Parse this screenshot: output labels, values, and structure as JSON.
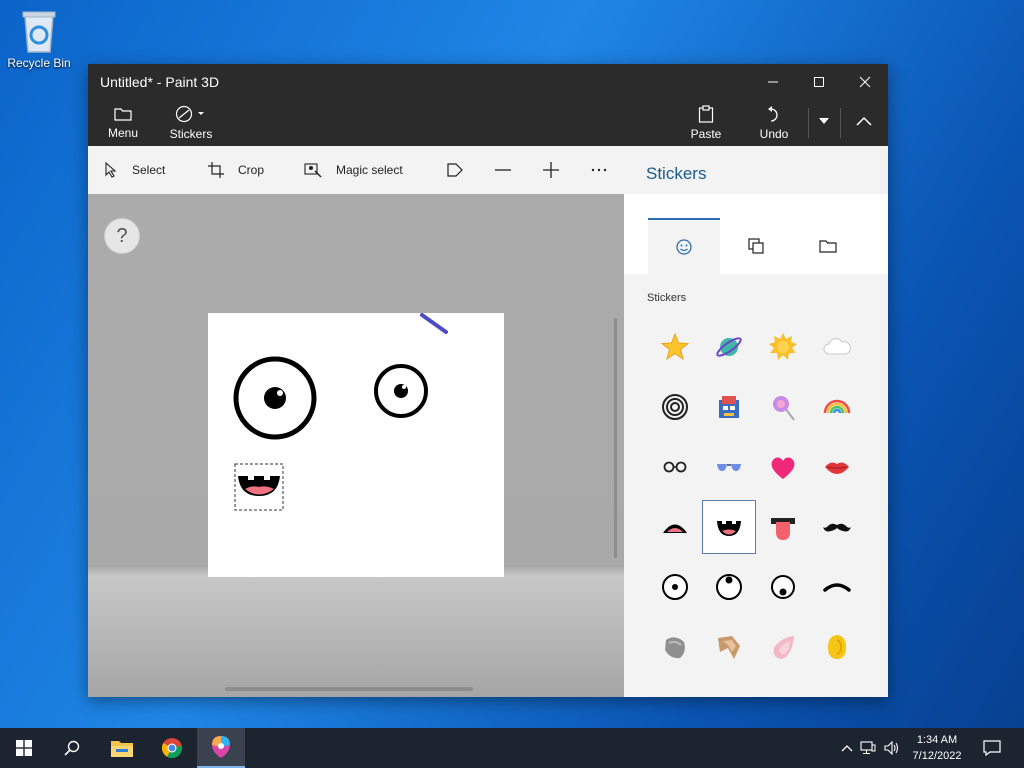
{
  "desktop": {
    "recycle_bin_label": "Recycle Bin"
  },
  "window": {
    "title": "Untitled* - Paint 3D",
    "ribbon": {
      "menu_label": "Menu",
      "stickers_label": "Stickers",
      "paste_label": "Paste",
      "undo_label": "Undo"
    },
    "toolbar": {
      "select_label": "Select",
      "crop_label": "Crop",
      "magic_select_label": "Magic select"
    },
    "canvas": {
      "help_label": "?"
    },
    "panel": {
      "title": "Stickers",
      "tabs": [
        {
          "icon": "sticker-face-icon",
          "active": true
        },
        {
          "icon": "texture-icon"
        },
        {
          "icon": "folder-icon"
        }
      ],
      "section_label": "Stickers",
      "stickers": [
        "star-sticker",
        "planet-sticker",
        "sun-sticker",
        "cloud-sticker",
        "spiral-sticker",
        "robot-sticker",
        "lollipop-sticker",
        "rainbow-sticker",
        "glasses-sticker",
        "sunglasses-sticker",
        "heart-sticker",
        "lips-sticker",
        "mouth-frown-sticker",
        "mouth-smile-sticker",
        "tongue-sticker",
        "mustache-sticker",
        "eye-center-sticker",
        "eye-up-sticker",
        "eye-down-sticker",
        "eyebrow-sticker",
        "ear-gray-sticker",
        "ear-brown-sticker",
        "ear-pink-sticker",
        "ear-yellow-sticker"
      ],
      "selected_sticker": "mouth-smile-sticker"
    }
  },
  "taskbar": {
    "time": "1:34 AM",
    "date": "7/12/2022"
  },
  "colors": {
    "accent": "#2a6fb0",
    "titlebar": "#2b2b2b",
    "panel_title": "#1a5a8c"
  }
}
